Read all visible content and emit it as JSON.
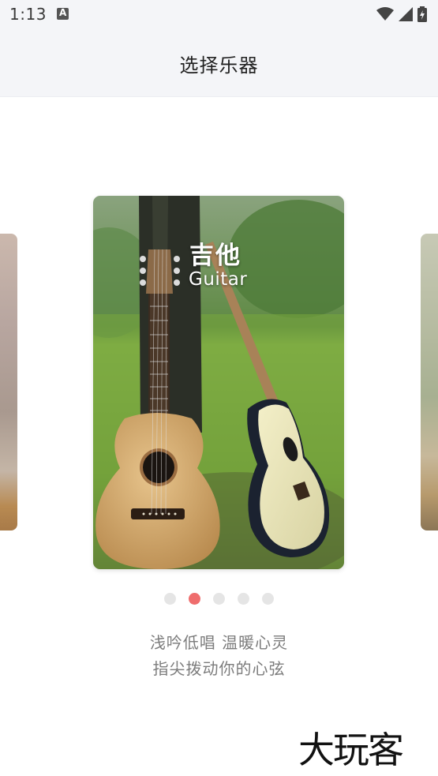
{
  "status_bar": {
    "time": "1:13",
    "notification_icon": "a-letter-icon",
    "icons": [
      "wifi-icon",
      "signal-icon",
      "battery-icon"
    ]
  },
  "app_bar": {
    "title": "选择乐器"
  },
  "carousel": {
    "current_index": 1,
    "total": 5,
    "card": {
      "title": "吉他",
      "subtitle": "Guitar"
    }
  },
  "description": {
    "line1": "浅吟低唱 温暖心灵",
    "line2": "指尖拨动你的心弦"
  },
  "watermark": "大玩客",
  "colors": {
    "dot_active": "#ef6d6d",
    "dot_inactive": "#e5e5e5",
    "appbar_bg": "#f4f5f8"
  }
}
